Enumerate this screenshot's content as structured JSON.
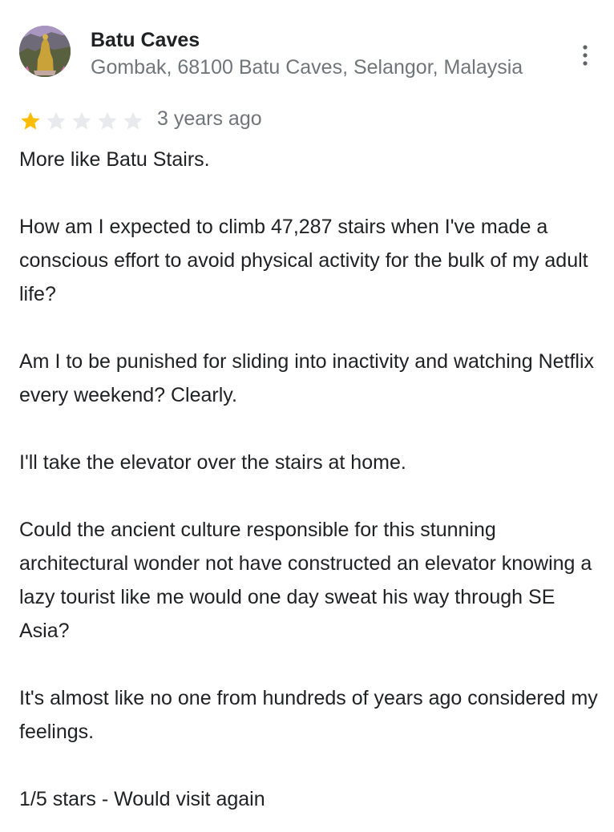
{
  "place": {
    "name": "Batu Caves",
    "address": "Gombak, 68100 Batu Caves, Selangor, Malaysia",
    "avatar_icon": "temple-statue-photo"
  },
  "menu": {
    "icon": "more-vert-icon"
  },
  "review": {
    "rating": 1,
    "max_rating": 5,
    "star_filled_color": "#fbbc04",
    "star_empty_color": "#e8eaed",
    "date": "3 years ago",
    "paragraphs": [
      "More like Batu Stairs.",
      "How am I expected to climb 47,287 stairs when I've made a conscious effort to avoid physical activity for the bulk of my adult life?",
      "Am I to be punished for sliding into inactivity and watching Netflix every weekend? Clearly.",
      "I'll take the elevator over the stairs at home.",
      "Could the ancient culture responsible for this stunning architectural wonder not have constructed an elevator knowing a lazy tourist like me would one day sweat his way through SE Asia?",
      "It's almost like no one from hundreds of years ago considered my feelings.",
      "1/5 stars - Would visit again"
    ]
  }
}
